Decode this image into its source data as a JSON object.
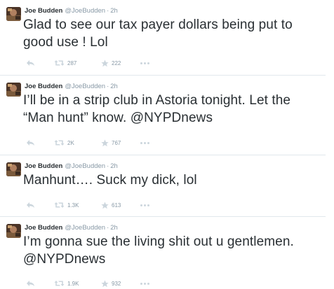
{
  "tweets": [
    {
      "fullname": "Joe Budden",
      "username": "@JoeBudden",
      "time": "2h",
      "text": "Glad to see our tax payer dollars being put to good use ! Lol",
      "retweets": "287",
      "favorites": "222"
    },
    {
      "fullname": "Joe Budden",
      "username": "@JoeBudden",
      "time": "2h",
      "text": "I’ll be in a strip club in Astoria tonight. Let the “Man hunt” know. @NYPDnews",
      "retweets": "2K",
      "favorites": "767"
    },
    {
      "fullname": "Joe Budden",
      "username": "@JoeBudden",
      "time": "2h",
      "text": "Manhunt…. Suck my dick, lol",
      "retweets": "1.3K",
      "favorites": "613"
    },
    {
      "fullname": "Joe Budden",
      "username": "@JoeBudden",
      "time": "2h",
      "text": "I’m gonna sue the living shit out u gentlemen. @NYPDnews",
      "retweets": "1.9K",
      "favorites": "932"
    }
  ],
  "colors": {
    "text": "#292f33",
    "muted": "#8899a6",
    "icon": "#ccd6dd",
    "divider": "#e1e8ed"
  },
  "icons": {
    "reply": "reply-icon",
    "retweet": "retweet-icon",
    "favorite": "star-icon",
    "more": "more-dots-icon"
  }
}
